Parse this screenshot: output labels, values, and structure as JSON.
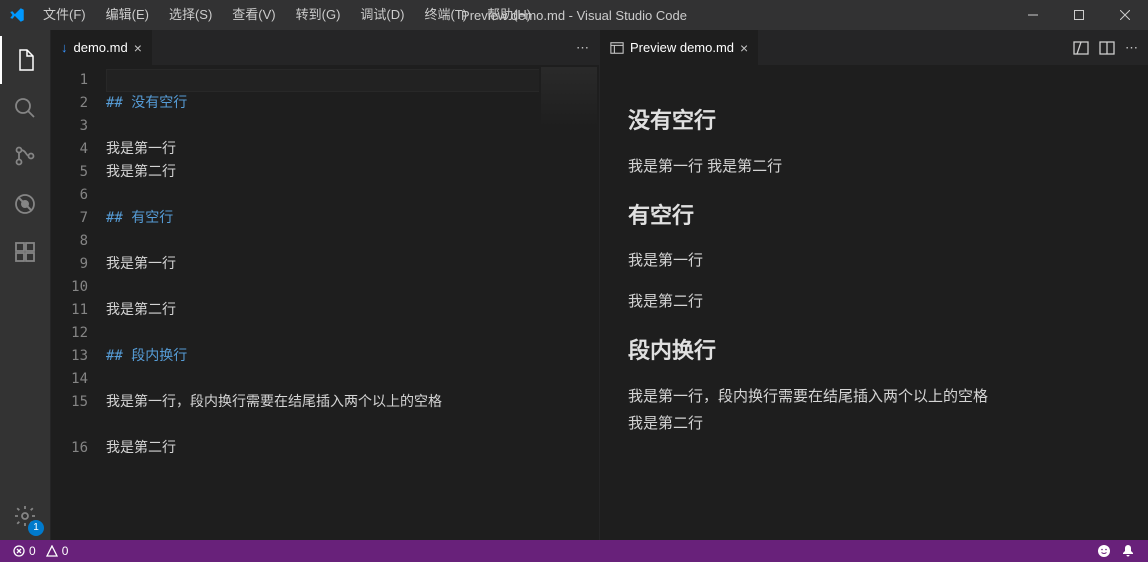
{
  "titlebar": {
    "title": "Preview demo.md - Visual Studio Code",
    "menus": [
      "文件(F)",
      "编辑(E)",
      "选择(S)",
      "查看(V)",
      "转到(G)",
      "调试(D)",
      "终端(T)",
      "帮助(H)"
    ]
  },
  "activitybar": {
    "settings_badge": "1"
  },
  "editorTab": {
    "filename": "demo.md"
  },
  "previewTab": {
    "filename": "Preview demo.md"
  },
  "code": {
    "lineNumbers": [
      "1",
      "2",
      "3",
      "4",
      "5",
      "6",
      "7",
      "8",
      "9",
      "10",
      "11",
      "12",
      "13",
      "14",
      "15",
      "",
      "16"
    ],
    "lines": [
      {
        "t": "",
        "cls": ""
      },
      {
        "t": "## 没有空行",
        "cls": "mdh"
      },
      {
        "t": "",
        "cls": ""
      },
      {
        "t": "我是第一行",
        "cls": ""
      },
      {
        "t": "我是第二行",
        "cls": ""
      },
      {
        "t": "",
        "cls": ""
      },
      {
        "t": "## 有空行",
        "cls": "mdh"
      },
      {
        "t": "",
        "cls": ""
      },
      {
        "t": "我是第一行",
        "cls": ""
      },
      {
        "t": "",
        "cls": ""
      },
      {
        "t": "我是第二行",
        "cls": ""
      },
      {
        "t": "",
        "cls": ""
      },
      {
        "t": "## 段内换行",
        "cls": "mdh"
      },
      {
        "t": "",
        "cls": ""
      },
      {
        "t": "我是第一行，段内换行需要在结尾插入两个以上的空格",
        "cls": ""
      },
      {
        "t": "",
        "cls": ""
      },
      {
        "t": "我是第二行",
        "cls": ""
      }
    ]
  },
  "preview": {
    "h1": "没有空行",
    "p1": "我是第一行 我是第二行",
    "h2": "有空行",
    "p2a": "我是第一行",
    "p2b": "我是第二行",
    "h3": "段内换行",
    "p3a": "我是第一行，段内换行需要在结尾插入两个以上的空格",
    "p3b": "我是第二行"
  },
  "statusbar": {
    "errors": "0",
    "warnings": "0"
  }
}
